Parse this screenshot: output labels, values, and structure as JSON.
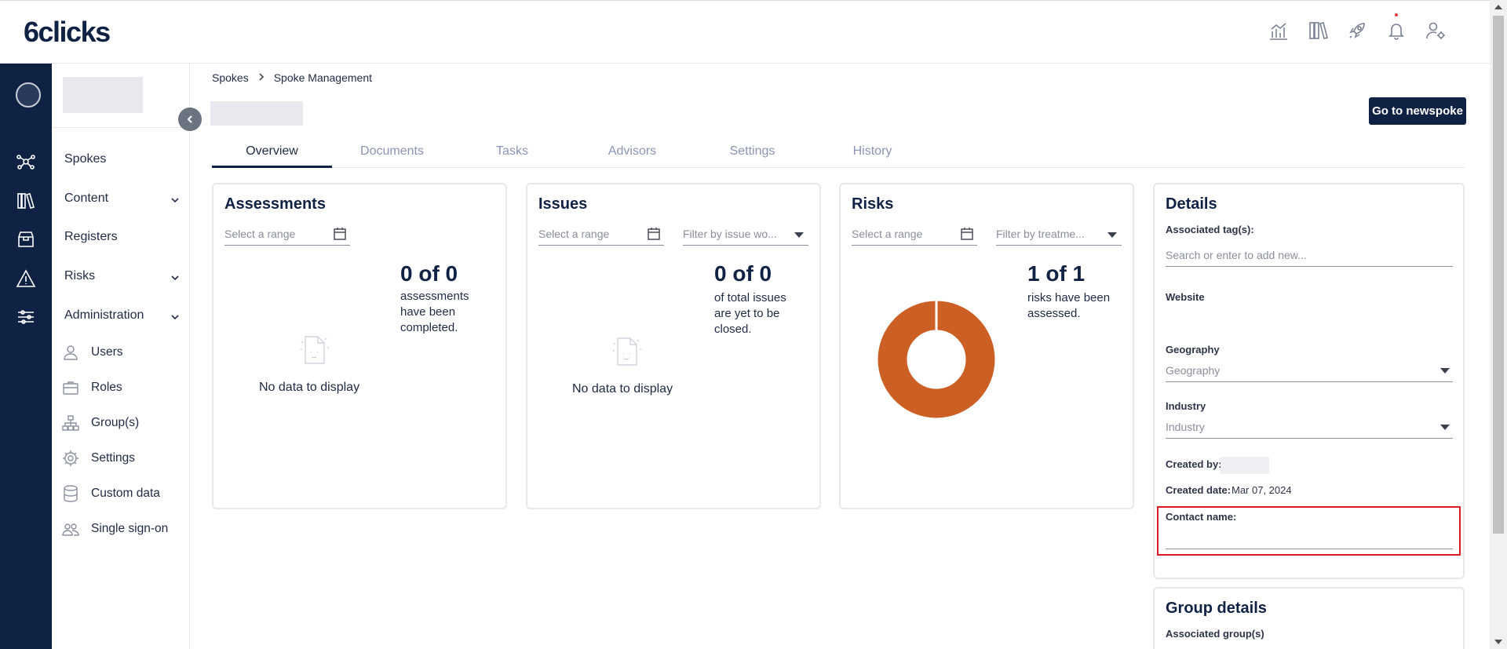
{
  "header": {
    "logo": "6clicks",
    "icons": [
      "analytics-icon",
      "library-icon",
      "rocket-icon",
      "bell-icon",
      "user-settings-icon"
    ]
  },
  "rail": {
    "icons": [
      "hub-network-icon",
      "library-icon",
      "box-icon",
      "warning-icon",
      "sliders-icon"
    ]
  },
  "sidebar": {
    "items": [
      {
        "label": "Spokes"
      },
      {
        "label": "Content"
      },
      {
        "label": "Registers"
      },
      {
        "label": "Risks"
      },
      {
        "label": "Administration"
      }
    ],
    "admin_items": [
      {
        "label": "Users",
        "icon": "user-icon"
      },
      {
        "label": "Roles",
        "icon": "briefcase-icon"
      },
      {
        "label": "Group(s)",
        "icon": "org-chart-icon"
      },
      {
        "label": "Settings",
        "icon": "gear-icon"
      },
      {
        "label": "Custom data",
        "icon": "database-icon"
      },
      {
        "label": "Single sign-on",
        "icon": "users-icon"
      }
    ]
  },
  "breadcrumb": {
    "items": [
      "Spokes",
      "Spoke Management"
    ]
  },
  "actions": {
    "go_to_newspoke": "Go to newspoke"
  },
  "tabs": [
    "Overview",
    "Documents",
    "Tasks",
    "Advisors",
    "Settings",
    "History"
  ],
  "assessments": {
    "title": "Assessments",
    "range_placeholder": "Select a range",
    "count": "0 of 0",
    "desc": "assessments have been completed.",
    "nodata": "No data to display"
  },
  "issues": {
    "title": "Issues",
    "range_placeholder": "Select a range",
    "filter_placeholder": "Filter by issue wo...",
    "count": "0 of 0",
    "desc": "of total issues are yet to be closed.",
    "nodata": "No data to display"
  },
  "risks": {
    "title": "Risks",
    "range_placeholder": "Select a range",
    "filter_placeholder": "Filter by treatme...",
    "count": "1 of 1",
    "desc": "risks have been assessed.",
    "donut_color": "#cc6024",
    "donut_fraction": 1
  },
  "details": {
    "title": "Details",
    "tags_label": "Associated tag(s):",
    "tags_placeholder": "Search or enter to add new...",
    "website_label": "Website",
    "geography_label": "Geography",
    "geography_placeholder": "Geography",
    "industry_label": "Industry",
    "industry_placeholder": "Industry",
    "created_by_label": "Created by:",
    "created_date_label": "Created date:",
    "created_date_value": "Mar 07, 2024",
    "contact_label": "Contact name:"
  },
  "group_details": {
    "title": "Group details",
    "associated_label": "Associated group(s)"
  },
  "colors": {
    "brand": "#0f2244",
    "highlight": "#d81b23",
    "donut": "#cc6024"
  }
}
